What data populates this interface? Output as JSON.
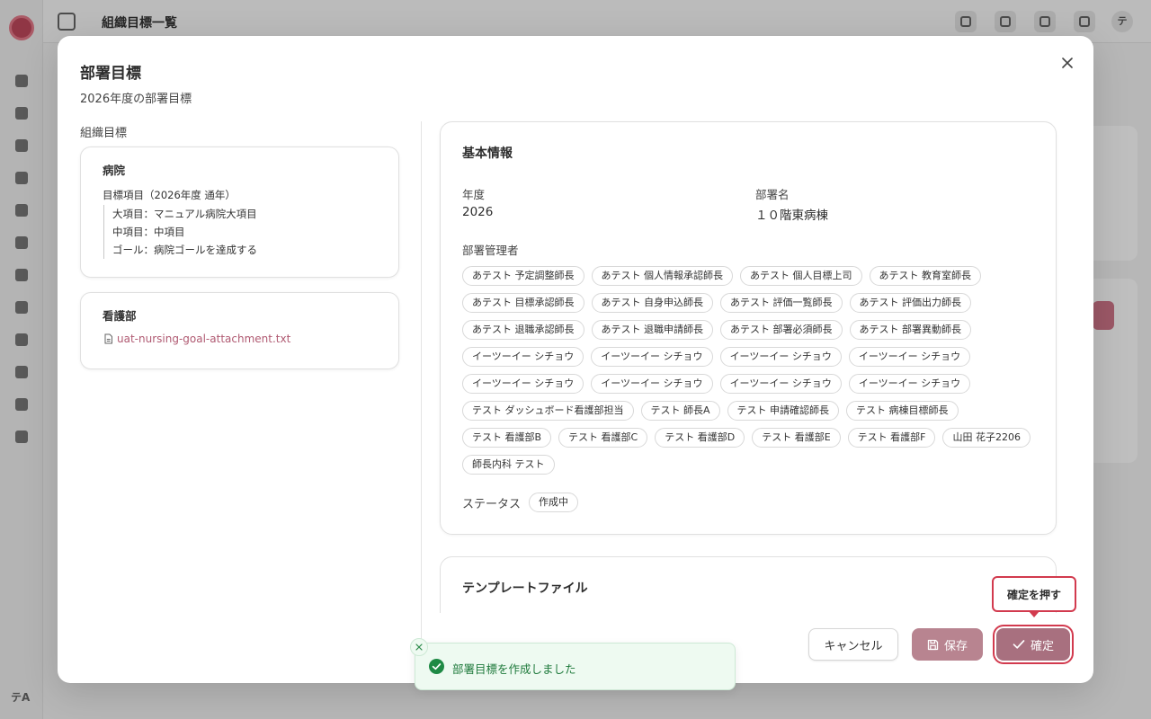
{
  "background": {
    "page_title": "組織目標一覧",
    "sidebar_avatar": "テA",
    "header_avatar": "テ"
  },
  "modal": {
    "title": "部署目標",
    "subtitle": "2026年度の部署目標",
    "org_goals_heading": "組織目標",
    "hospital": {
      "title": "病院",
      "item_head": "目標項目（2026年度 通年）",
      "lines": [
        "大項目：マニュアル病院大項目",
        "中項目：中項目",
        "ゴール：病院ゴールを達成する"
      ]
    },
    "nursing": {
      "title": "看護部",
      "attachment": "uat-nursing-goal-attachment.txt"
    },
    "basic_info": {
      "title": "基本情報",
      "year_label": "年度",
      "year_value": "2026",
      "dept_label": "部署名",
      "dept_value": "１０階東病棟",
      "managers_label": "部署管理者",
      "managers": [
        "あテスト 予定調整師長",
        "あテスト 個人情報承認師長",
        "あテスト 個人目標上司",
        "あテスト 教育室師長",
        "あテスト 目標承認師長",
        "あテスト 自身申込師長",
        "あテスト 評価一覧師長",
        "あテスト 評価出力師長",
        "あテスト 退職承認師長",
        "あテスト 退職申請師長",
        "あテスト 部署必須師長",
        "あテスト 部署異動師長",
        "イーツーイー シチョウ",
        "イーツーイー シチョウ",
        "イーツーイー シチョウ",
        "イーツーイー シチョウ",
        "イーツーイー シチョウ",
        "イーツーイー シチョウ",
        "イーツーイー シチョウ",
        "イーツーイー シチョウ",
        "テスト ダッシュボード看護部担当",
        "テスト 師長A",
        "テスト 申請確認師長",
        "テスト 病棟目標師長",
        "テスト 看護部B",
        "テスト 看護部C",
        "テスト 看護部D",
        "テスト 看護部E",
        "テスト 看護部F",
        "山田 花子2206",
        "師長内科 テスト"
      ],
      "status_label": "ステータス",
      "status_value": "作成中"
    },
    "template": {
      "title": "テンプレートファイル"
    },
    "buttons": {
      "cancel": "キャンセル",
      "save": "保存",
      "confirm": "確定"
    },
    "tooltip": "確定を押す",
    "toast": "部署目標を作成しました"
  },
  "colors": {
    "accent": "#b05a72",
    "confirm_button": "#a8707f",
    "save_button": "#b88490",
    "highlight": "#d23a4e",
    "success": "#1f7a3c"
  }
}
